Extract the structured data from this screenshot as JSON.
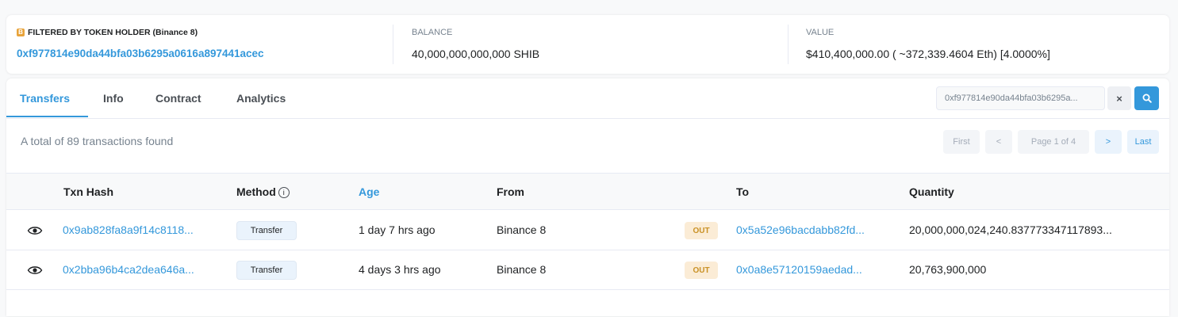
{
  "summary": {
    "filter_label": "FILTERED BY TOKEN HOLDER (Binance 8)",
    "filter_icon_letter": "B",
    "holder_address": "0xf977814e90da44bfa03b6295a0616a897441acec",
    "balance_label": "BALANCE",
    "balance_value": "40,000,000,000,000 SHIB",
    "value_label": "VALUE",
    "value_value": "$410,400,000.00 ( ~372,339.4604 Eth) [4.0000%]"
  },
  "tabs": [
    {
      "label": "Transfers",
      "active": true
    },
    {
      "label": "Info"
    },
    {
      "label": "Contract"
    },
    {
      "label": "Analytics"
    }
  ],
  "filter": {
    "value": "0xf977814e90da44bfa03b6295a...",
    "clear_label": "×"
  },
  "total_text": "A total of 89 transactions found",
  "pagination": {
    "first": "First",
    "prev": "<",
    "page": "Page 1 of 4",
    "next": ">",
    "last": "Last"
  },
  "table": {
    "headers": {
      "txn_hash": "Txn Hash",
      "method": "Method",
      "age": "Age",
      "from": "From",
      "to": "To",
      "quantity": "Quantity"
    },
    "rows": [
      {
        "txn_hash": "0x9ab828fa8a9f14c8118...",
        "method": "Transfer",
        "age": "1 day 7 hrs ago",
        "from": "Binance 8",
        "direction": "OUT",
        "to": "0x5a52e96bacdabb82fd...",
        "quantity": "20,000,000,024,240.837773347117893..."
      },
      {
        "txn_hash": "0x2bba96b4ca2dea646a...",
        "method": "Transfer",
        "age": "4 days 3 hrs ago",
        "from": "Binance 8",
        "direction": "OUT",
        "to": "0x0a8e57120159aedad...",
        "quantity": "20,763,900,000"
      }
    ]
  },
  "colors": {
    "accent": "#3498db",
    "out_badge_bg": "#fbecd6",
    "out_badge_text": "#c99125",
    "filter_icon": "#e8a33a"
  },
  "icons": {
    "search": "search-icon",
    "clear": "close-icon",
    "eye": "eye-icon",
    "info": "info-circle-icon"
  }
}
